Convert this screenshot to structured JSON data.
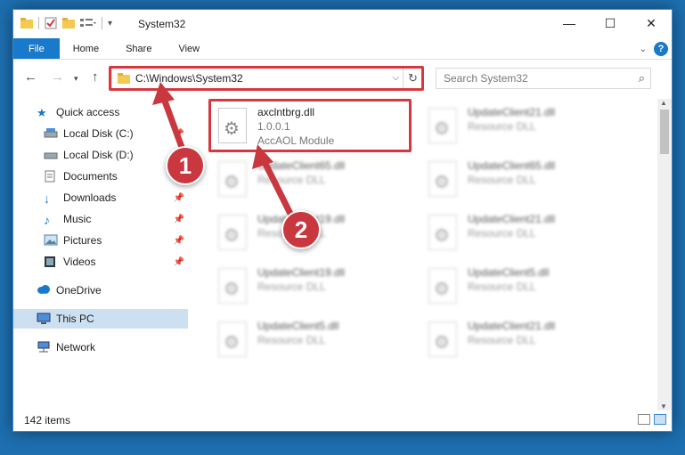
{
  "window": {
    "title": "System32"
  },
  "ribbon": {
    "tabs": [
      "File",
      "Home",
      "Share",
      "View"
    ],
    "help_label": "?"
  },
  "address": {
    "path": "C:\\Windows\\System32",
    "search_placeholder": "Search System32"
  },
  "nav": {
    "items": [
      {
        "label": "Quick access",
        "icon": "star-icon",
        "pinned": false
      },
      {
        "label": "Local Disk (C:)",
        "icon": "drive-icon",
        "pinned": true
      },
      {
        "label": "Local Disk (D:)",
        "icon": "drive-icon",
        "pinned": true
      },
      {
        "label": "Documents",
        "icon": "documents-icon",
        "pinned": true
      },
      {
        "label": "Downloads",
        "icon": "download-icon",
        "pinned": true
      },
      {
        "label": "Music",
        "icon": "music-icon",
        "pinned": true
      },
      {
        "label": "Pictures",
        "icon": "pictures-icon",
        "pinned": true
      },
      {
        "label": "Videos",
        "icon": "videos-icon",
        "pinned": true
      },
      {
        "label": "OneDrive",
        "icon": "cloud-icon",
        "pinned": false
      },
      {
        "label": "This PC",
        "icon": "computer-icon",
        "pinned": false
      },
      {
        "label": "Network",
        "icon": "network-icon",
        "pinned": false
      }
    ]
  },
  "files": {
    "highlighted": {
      "name": "axclntbrg.dll",
      "version": "1.0.0.1",
      "description": "AccAOL Module"
    },
    "col1": [
      {
        "name": "UpdateClient65.dll",
        "description": "Resource DLL"
      },
      {
        "name": "UpdateClient19.dll",
        "description": "Resource DLL"
      },
      {
        "name": "UpdateClient19.dll",
        "description": "Resource DLL"
      },
      {
        "name": "UpdateClient5.dll",
        "description": "Resource DLL"
      }
    ],
    "col2": [
      {
        "name": "UpdateClient21.dll",
        "description": "Resource DLL"
      },
      {
        "name": "UpdateClient65.dll",
        "description": "Resource DLL"
      },
      {
        "name": "UpdateClient21.dll",
        "description": "Resource DLL"
      },
      {
        "name": "UpdateClient5.dll",
        "description": "Resource DLL"
      },
      {
        "name": "UpdateClient21.dll",
        "description": "Resource DLL"
      }
    ]
  },
  "status": {
    "item_count": "142 items"
  },
  "callouts": {
    "one": "1",
    "two": "2",
    "color": "#c9373f"
  }
}
